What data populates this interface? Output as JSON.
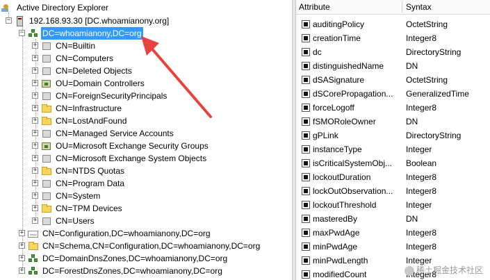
{
  "tree": {
    "root_label": "Active Directory Explorer",
    "server_label": "192.168.93.30 [DC.whoamianony.org]",
    "domain_label": "DC=whoamianony,DC=org",
    "children": [
      {
        "label": "CN=Builtin",
        "icon": "container"
      },
      {
        "label": "CN=Computers",
        "icon": "container"
      },
      {
        "label": "CN=Deleted Objects",
        "icon": "container"
      },
      {
        "label": "OU=Domain Controllers",
        "icon": "ou"
      },
      {
        "label": "CN=ForeignSecurityPrincipals",
        "icon": "container"
      },
      {
        "label": "CN=Infrastructure",
        "icon": "folder"
      },
      {
        "label": "CN=LostAndFound",
        "icon": "folder"
      },
      {
        "label": "CN=Managed Service Accounts",
        "icon": "container"
      },
      {
        "label": "OU=Microsoft Exchange Security Groups",
        "icon": "ou"
      },
      {
        "label": "CN=Microsoft Exchange System Objects",
        "icon": "container"
      },
      {
        "label": "CN=NTDS Quotas",
        "icon": "folder"
      },
      {
        "label": "CN=Program Data",
        "icon": "container"
      },
      {
        "label": "CN=System",
        "icon": "container"
      },
      {
        "label": "CN=TPM Devices",
        "icon": "folder"
      },
      {
        "label": "CN=Users",
        "icon": "container"
      }
    ],
    "siblings": [
      {
        "label": "CN=Configuration,DC=whoamianony,DC=org",
        "icon": "configuration"
      },
      {
        "label": "CN=Schema,CN=Configuration,DC=whoamianony,DC=org",
        "icon": "folder"
      },
      {
        "label": "DC=DomainDnsZones,DC=whoamianony,DC=org",
        "icon": "domain"
      },
      {
        "label": "DC=ForestDnsZones,DC=whoamianony,DC=org",
        "icon": "domain"
      }
    ]
  },
  "attributes": {
    "header": {
      "attribute": "Attribute",
      "syntax": "Syntax"
    },
    "rows": [
      {
        "name": "auditingPolicy",
        "syntax": "OctetString"
      },
      {
        "name": "creationTime",
        "syntax": "Integer8"
      },
      {
        "name": "dc",
        "syntax": "DirectoryString"
      },
      {
        "name": "distinguishedName",
        "syntax": "DN"
      },
      {
        "name": "dSASignature",
        "syntax": "OctetString"
      },
      {
        "name": "dSCorePropagation...",
        "syntax": "GeneralizedTime"
      },
      {
        "name": "forceLogoff",
        "syntax": "Integer8"
      },
      {
        "name": "fSMORoleOwner",
        "syntax": "DN"
      },
      {
        "name": "gPLink",
        "syntax": "DirectoryString"
      },
      {
        "name": "instanceType",
        "syntax": "Integer"
      },
      {
        "name": "isCriticalSystemObj...",
        "syntax": "Boolean"
      },
      {
        "name": "lockoutDuration",
        "syntax": "Integer8"
      },
      {
        "name": "lockOutObservation...",
        "syntax": "Integer8"
      },
      {
        "name": "lockoutThreshold",
        "syntax": "Integer"
      },
      {
        "name": "masteredBy",
        "syntax": "DN"
      },
      {
        "name": "maxPwdAge",
        "syntax": "Integer8"
      },
      {
        "name": "minPwdAge",
        "syntax": "Integer8"
      },
      {
        "name": "minPwdLength",
        "syntax": "Integer"
      },
      {
        "name": "modifiedCount",
        "syntax": "Integer8"
      }
    ]
  },
  "watermark": "稀土掘金技术社区",
  "colors": {
    "selection": "#3399ff",
    "arrow": "#e8423f"
  }
}
